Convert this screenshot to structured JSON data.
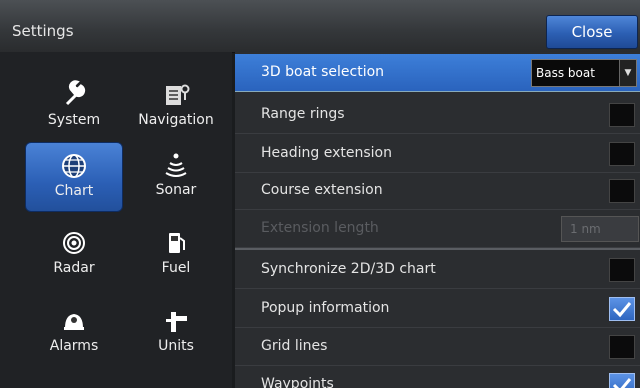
{
  "window": {
    "title": "Settings",
    "close_label": "Close"
  },
  "sidebar": {
    "items": [
      {
        "label": "System",
        "icon": "wrench-icon"
      },
      {
        "label": "Navigation",
        "icon": "navigation-icon"
      },
      {
        "label": "Chart",
        "icon": "globe-icon",
        "active": true
      },
      {
        "label": "Sonar",
        "icon": "sonar-icon"
      },
      {
        "label": "Radar",
        "icon": "radar-icon"
      },
      {
        "label": "Fuel",
        "icon": "fuel-pump-icon"
      },
      {
        "label": "Alarms",
        "icon": "alarm-bell-icon"
      },
      {
        "label": "Units",
        "icon": "units-icon"
      }
    ]
  },
  "settings": {
    "boat_selection": {
      "label": "3D boat selection",
      "value": "Bass boat"
    },
    "range_rings": {
      "label": "Range rings",
      "checked": false
    },
    "heading_extension": {
      "label": "Heading extension",
      "checked": false
    },
    "course_extension": {
      "label": "Course extension",
      "checked": false
    },
    "extension_length": {
      "label": "Extension length",
      "value": "1 nm"
    },
    "synchronize": {
      "label": "Synchronize 2D/3D chart",
      "checked": false
    },
    "popup_information": {
      "label": "Popup information",
      "checked": true
    },
    "grid_lines": {
      "label": "Grid lines",
      "checked": false
    },
    "waypoints": {
      "label": "Waypoints",
      "checked": true
    }
  },
  "colors": {
    "accent": "#2f6fd0",
    "background": "#2b2d30"
  }
}
